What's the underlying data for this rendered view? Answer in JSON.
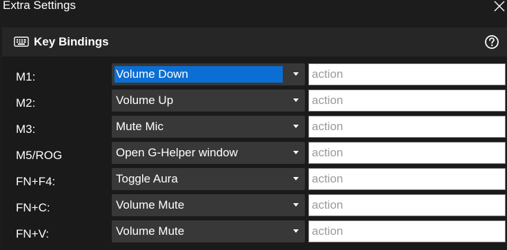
{
  "window": {
    "title": "Extra Settings",
    "close_icon": "close-icon"
  },
  "panel": {
    "icon": "keyboard-icon",
    "title": "Key Bindings",
    "help_icon": "help-circle-icon"
  },
  "bindings": [
    {
      "key": "M1:",
      "action": "Volume Down",
      "input_value": "",
      "input_placeholder": "action",
      "focused": true
    },
    {
      "key": "M2:",
      "action": "Volume Up",
      "input_value": "",
      "input_placeholder": "action"
    },
    {
      "key": "M3:",
      "action": "Mute Mic",
      "input_value": "",
      "input_placeholder": "action"
    },
    {
      "key": "M5/ROG",
      "action": "Open G-Helper window",
      "input_value": "",
      "input_placeholder": "action"
    },
    {
      "key": "FN+F4:",
      "action": "Toggle Aura",
      "input_value": "",
      "input_placeholder": "action"
    },
    {
      "key": "FN+C:",
      "action": "Volume Mute",
      "input_value": "",
      "input_placeholder": "action"
    },
    {
      "key": "FN+V:",
      "action": "Volume Mute",
      "input_value": "",
      "input_placeholder": "action"
    }
  ],
  "colors": {
    "background": "#1c1c1c",
    "header": "#262626",
    "select": "#383838",
    "selection": "#0b6ed4"
  }
}
